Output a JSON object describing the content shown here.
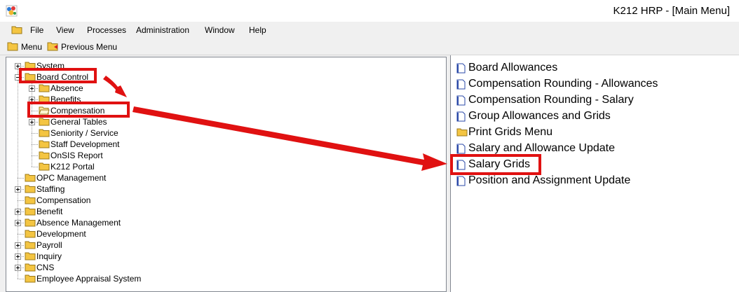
{
  "window": {
    "title": "K212 HRP - [Main Menu]"
  },
  "menubar": {
    "items": [
      "File",
      "View",
      "Processes",
      "Administration",
      "Window",
      "Help"
    ]
  },
  "toolbar": {
    "menu_label": "Menu",
    "previous_label": "Previous Menu"
  },
  "tree": {
    "items": [
      "System",
      "Board Control",
      "Absence",
      "Benefits",
      "Compensation",
      "General Tables",
      "Seniority / Service",
      "Staff Development",
      "OnSIS Report",
      "K212 Portal",
      "OPC Management",
      "Staffing",
      "Compensation",
      "Benefit",
      "Absence Management",
      "Development",
      "Payroll",
      "Inquiry",
      "CNS",
      "Employee Appraisal System"
    ]
  },
  "right_list": {
    "items": [
      "Board Allowances",
      "Compensation Rounding - Allowances",
      "Compensation Rounding - Salary",
      "Group Allowances and Grids",
      "Print Grids Menu",
      "Salary and Allowance Update",
      "Salary Grids",
      "Position and Assignment Update"
    ]
  },
  "icons": {
    "app": "k212-app-icon",
    "system_menu": "folder-icon",
    "toolbar_menu": "folder-icon",
    "toolbar_previous": "previous-menu-icon",
    "tree_folder": "folder-icon",
    "tree_open_folder": "open-folder-icon",
    "document": "document-icon"
  },
  "colors": {
    "callout": "#e01111",
    "folder": "#f4c542",
    "document": "#2b4aa8"
  }
}
